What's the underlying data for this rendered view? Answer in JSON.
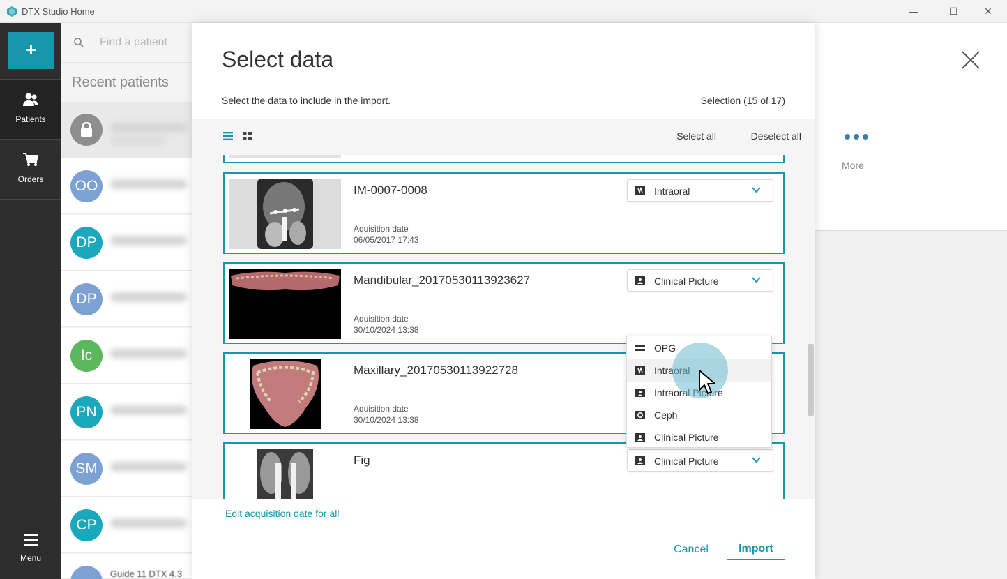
{
  "window": {
    "title": "DTX Studio Home",
    "controls": {
      "minimize": "—",
      "maximize": "☐",
      "close": "✕"
    }
  },
  "nav": {
    "add_label": "+",
    "items": [
      {
        "label": "Patients",
        "icon": "patients-icon",
        "active": true
      },
      {
        "label": "Orders",
        "icon": "cart-icon",
        "active": false
      }
    ],
    "menu_label": "Menu"
  },
  "patients": {
    "search_placeholder": "Find a patient",
    "recent_title": "Recent patients",
    "list": [
      {
        "initials": "",
        "locked": true,
        "color": "#8e8e8e"
      },
      {
        "initials": "OO",
        "color": "#7ea1d4"
      },
      {
        "initials": "DP",
        "color": "#1aa9bc"
      },
      {
        "initials": "DP",
        "color": "#7ea1d4"
      },
      {
        "initials": "Ic",
        "color": "#5cb85c"
      },
      {
        "initials": "PN",
        "color": "#1aa9bc"
      },
      {
        "initials": "SM",
        "color": "#7ea1d4"
      },
      {
        "initials": "CP",
        "color": "#1aa9bc"
      }
    ],
    "partial_name": "Guide 11 DTX 4.3"
  },
  "right_panel": {
    "more_label": "More"
  },
  "modal": {
    "title": "Select data",
    "subtitle": "Select the data to include in the import.",
    "selection": "Selection (15 of 17)",
    "select_all": "Select all",
    "deselect_all": "Deselect all",
    "items": [
      {
        "name": "IM-0007-0008",
        "date_label": "Aquisition date",
        "date": "06/05/2017 17:43",
        "type": "Intraoral",
        "type_icon": "intraoral-icon"
      },
      {
        "name": "Mandibular_20170530113923627",
        "date_label": "Aquisition date",
        "date": "30/10/2024 13:38",
        "type": "Clinical Picture",
        "type_icon": "clinical-picture-icon"
      },
      {
        "name": "Maxillary_20170530113922728",
        "date_label": "Aquisition date",
        "date": "30/10/2024 13:38",
        "type": "",
        "type_icon": ""
      },
      {
        "name": "Fig",
        "date_label": "",
        "date": "",
        "type": "Clinical Picture",
        "type_icon": "clinical-picture-icon"
      }
    ],
    "dropdown_options": [
      {
        "label": "OPG",
        "icon": "opg-icon"
      },
      {
        "label": "Intraoral",
        "icon": "intraoral-icon",
        "hovered": true
      },
      {
        "label": "Intraoral Picture",
        "icon": "intraoral-picture-icon"
      },
      {
        "label": "Ceph",
        "icon": "ceph-icon"
      },
      {
        "label": "Clinical Picture",
        "icon": "clinical-picture-icon"
      }
    ],
    "edit_date_link": "Edit acquisition date for all",
    "cancel": "Cancel",
    "import": "Import"
  },
  "colors": {
    "accent": "#1796ac",
    "nav_bg": "#2e2e2e"
  }
}
